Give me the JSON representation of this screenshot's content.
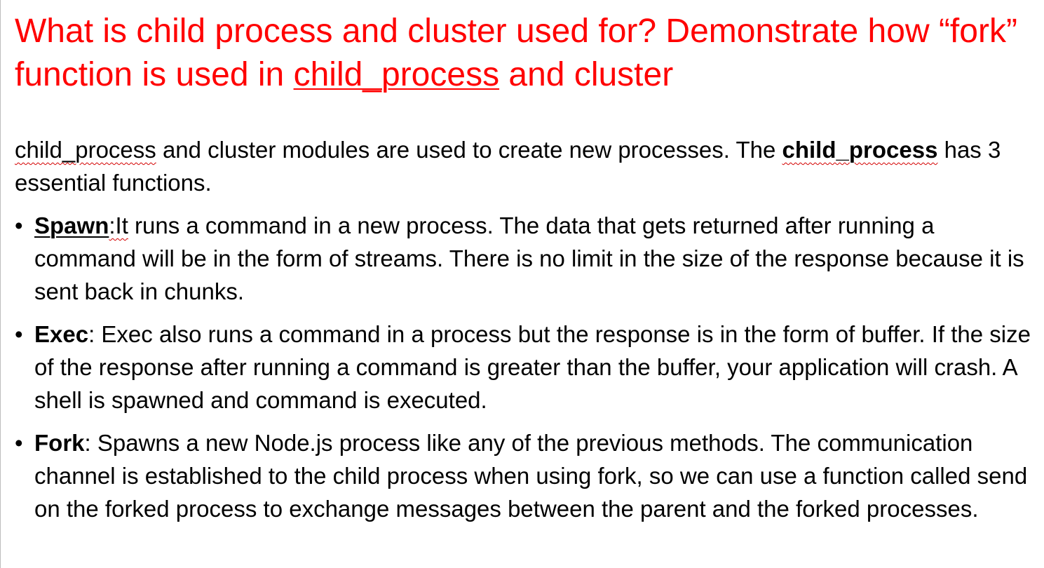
{
  "title": {
    "line_start": "What is child process and cluster used for? Demonstrate how “fork” function is used in ",
    "line_link": "child_process",
    "line_end": " and cluster"
  },
  "intro": {
    "term1": "child_process",
    "text1": " and cluster modules are used to create new processes. The ",
    "term2": "child_process",
    "text2": " has 3 essential functions."
  },
  "bullets": [
    {
      "term": "Spawn",
      "sep": ":It",
      "text": " runs a command in a new process. The data that gets returned after running a command will be in the form of streams. There is no limit in the size of the response because it is sent back in chunks."
    },
    {
      "term": "Exec",
      "sep": ":",
      "text": " Exec also runs a command in a process but the response is in the form of buffer. If the size of the response after running a command is greater than the buffer, your application will crash. A shell is spawned and command is executed."
    },
    {
      "term": "Fork",
      "sep": ":",
      "text": " Spawns a new Node.js process like any of the previous methods. The communication channel is established to the child process when using fork, so we can use a function called send on the forked process to exchange messages between the parent and the forked processes."
    }
  ],
  "bullet_char": "•",
  "colors": {
    "title": "#ff0000",
    "body": "#000000",
    "spellcheck": "#d40000"
  }
}
